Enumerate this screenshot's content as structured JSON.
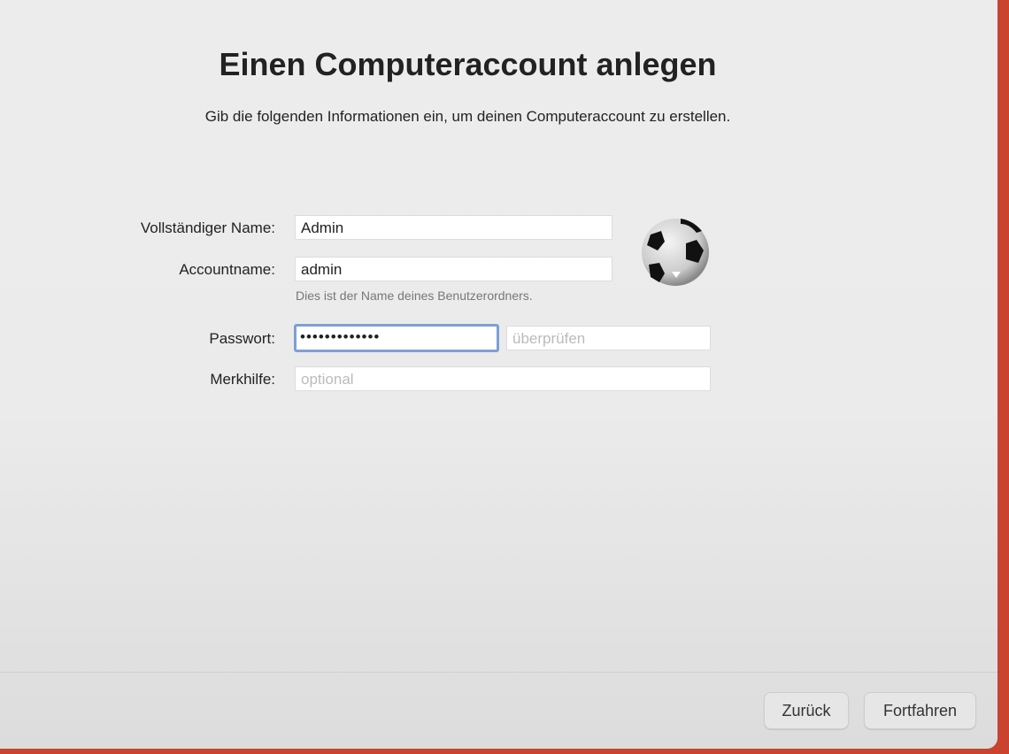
{
  "title": "Einen Computeraccount anlegen",
  "subtitle": "Gib die folgenden Informationen ein, um deinen Computeraccount zu erstellen.",
  "form": {
    "full_name": {
      "label": "Vollständiger Name:",
      "value": "Admin"
    },
    "account_name": {
      "label": "Accountname:",
      "value": "admin",
      "hint": "Dies ist der Name deines Benutzerordners."
    },
    "password": {
      "label": "Passwort:",
      "value": "•••••••••••••",
      "verify_placeholder": "überprüfen"
    },
    "hint": {
      "label": "Merkhilfe:",
      "placeholder": "optional"
    }
  },
  "avatar": {
    "icon": "soccer-ball"
  },
  "buttons": {
    "back": "Zurück",
    "continue": "Fortfahren"
  },
  "colors": {
    "background": "#c9432f",
    "focus": "#7c9fd6"
  }
}
